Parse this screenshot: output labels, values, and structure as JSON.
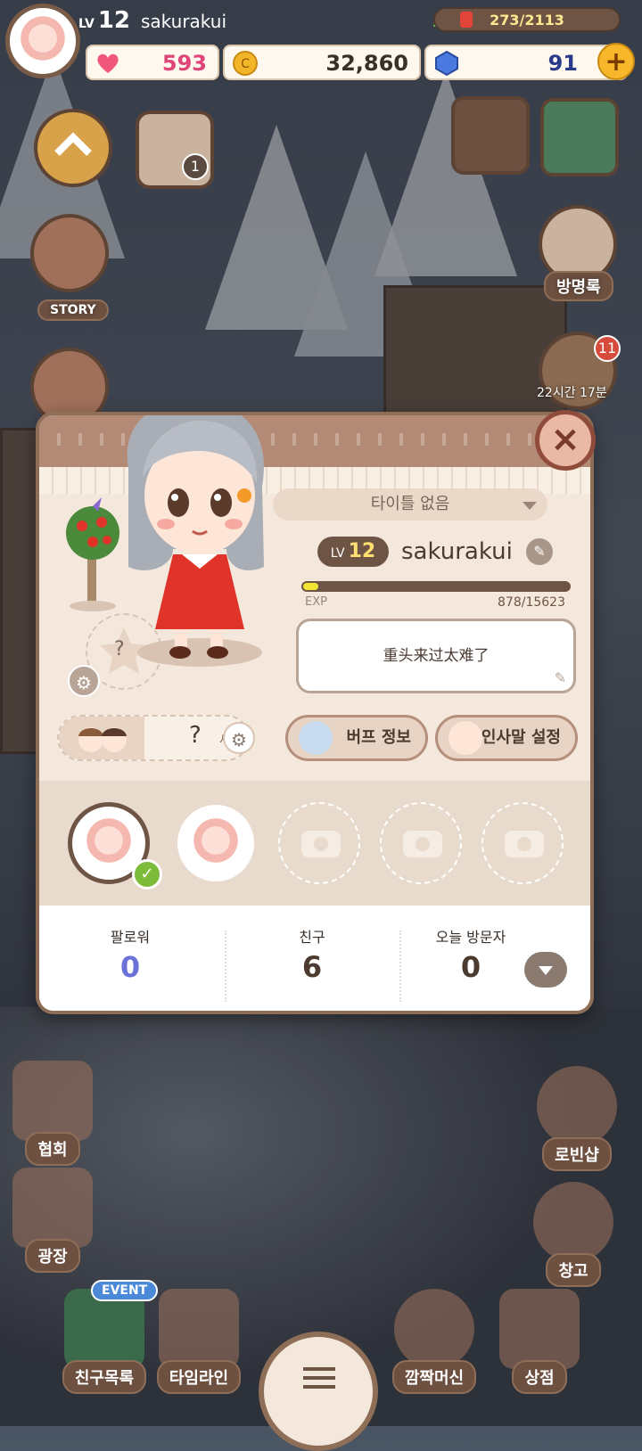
{
  "player": {
    "lv_label": "LV",
    "level": "12",
    "name": "sakurakui"
  },
  "resources": {
    "energy": "273/2113",
    "hearts": "593",
    "coins": "32,860",
    "gems": "91",
    "add_symbol": "+"
  },
  "side_left": {
    "story_label": "STORY",
    "calendar_badge": "1"
  },
  "side_right": {
    "guestbook_label": "방명록",
    "gift_badge": "11",
    "gift_timer": "22시간 17분"
  },
  "profile": {
    "title_dropdown": "타이틀 없음",
    "lv_label": "LV",
    "level": "12",
    "name": "sakurakui",
    "exp_label": "EXP",
    "exp_value": "878/15623",
    "exp_fraction": 0.056,
    "greeting": "重头来过太难了",
    "buff_button": "버프 정보",
    "greeting_button": "인사말 설정",
    "star_slot_mark": "?",
    "pair_mark": "?",
    "age_suffix": "세",
    "close_symbol": "×"
  },
  "stats": {
    "followers_label": "팔로워",
    "followers": "0",
    "friends_label": "친구",
    "friends": "6",
    "visitors_label": "오늘 방문자",
    "visitors": "0"
  },
  "bottom_nav": {
    "association": "협회",
    "plaza": "광장",
    "friend_list": "친구목록",
    "event_tag": "EVENT",
    "timeline": "타임라인",
    "surprise_machine": "깜짝머신",
    "shop": "상점",
    "robin_shop": "로빈샵",
    "storage": "창고"
  },
  "colors": {
    "brown": "#6e5444",
    "followers_value": "#6a72d8",
    "check_green": "#7dbb3a"
  }
}
